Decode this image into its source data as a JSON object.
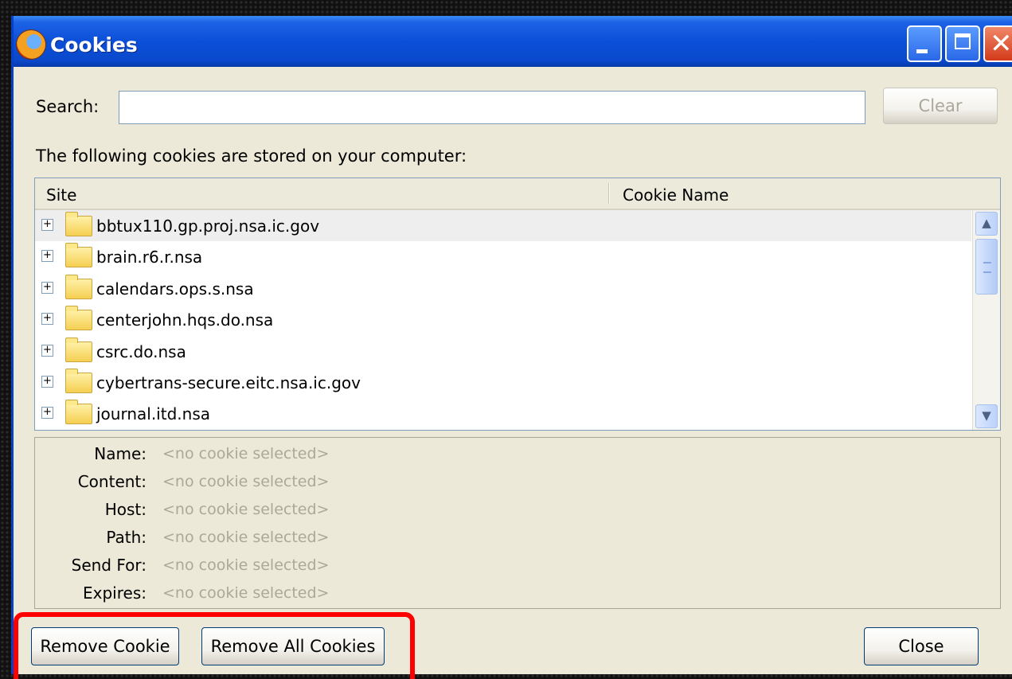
{
  "window": {
    "title": "Cookies",
    "icon": "firefox-icon"
  },
  "search": {
    "label": "Search:",
    "value": "",
    "placeholder": "",
    "clear_label": "Clear"
  },
  "intro_text": "The following cookies are stored on your computer:",
  "tree": {
    "columns": [
      "Site",
      "Cookie Name"
    ],
    "rows": [
      {
        "site": "bbtux110.gp.proj.nsa.ic.gov",
        "expander": "+"
      },
      {
        "site": "brain.r6.r.nsa",
        "expander": "+"
      },
      {
        "site": "calendars.ops.s.nsa",
        "expander": "+"
      },
      {
        "site": "centerjohn.hqs.do.nsa",
        "expander": "+"
      },
      {
        "site": "csrc.do.nsa",
        "expander": "+"
      },
      {
        "site": "cybertrans-secure.eitc.nsa.ic.gov",
        "expander": "+"
      },
      {
        "site": "journal.itd.nsa",
        "expander": "+"
      }
    ]
  },
  "details": [
    {
      "label": "Name:",
      "value": "<no cookie selected>"
    },
    {
      "label": "Content:",
      "value": "<no cookie selected>"
    },
    {
      "label": "Host:",
      "value": "<no cookie selected>"
    },
    {
      "label": "Path:",
      "value": "<no cookie selected>"
    },
    {
      "label": "Send For:",
      "value": "<no cookie selected>"
    },
    {
      "label": "Expires:",
      "value": "<no cookie selected>"
    }
  ],
  "buttons": {
    "remove_cookie": "Remove Cookie",
    "remove_all": "Remove All Cookies",
    "close": "Close"
  },
  "colors": {
    "titlebar": "#0b4fd8",
    "highlight": "#ff0000",
    "dialog_bg": "#ece9d8"
  }
}
